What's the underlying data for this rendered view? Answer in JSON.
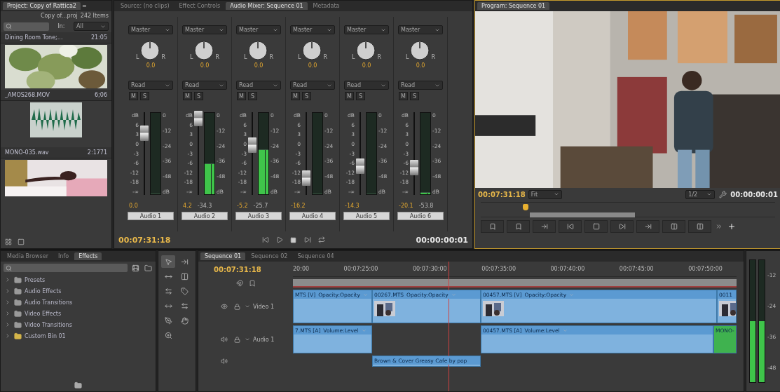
{
  "project": {
    "title": "Project: Copy of Rattica2",
    "menu": "≡",
    "path": "Copy of...proj",
    "count": "242 Items",
    "in_label": "In:",
    "in_value": "All",
    "items": [
      {
        "kind": "name-only",
        "name": "Dining Room Tone;...",
        "duration": "21:05"
      },
      {
        "kind": "video",
        "name": "_AMOS268.MOV",
        "duration": "6;06"
      },
      {
        "kind": "audio",
        "name": "MONO-035.wav",
        "duration": "2:1771"
      },
      {
        "kind": "video-cut"
      }
    ]
  },
  "mixer": {
    "tabs": [
      {
        "label": "Source: (no clips)",
        "selected": false
      },
      {
        "label": "Effect Controls",
        "selected": false
      },
      {
        "label": "Audio Mixer: Sequence 01",
        "selected": true
      },
      {
        "label": "Metadata",
        "selected": false
      }
    ],
    "channels": [
      {
        "send": "Master",
        "pan_left": "L",
        "pan_right": "R",
        "pan": "0.0",
        "automation": "Read",
        "mute": "M",
        "solo": "S",
        "fader_scale": [
          "dB",
          "6",
          "3",
          "0",
          "-3",
          "-6",
          "-12",
          "-18",
          "-∞"
        ],
        "meter_scale": [
          "0",
          "-12",
          "-24",
          "-36",
          "-48",
          "dB"
        ],
        "fader": {
          "level": 0.75
        },
        "meter": {
          "level": 0
        },
        "volume": "0.0",
        "name": "Audio 1"
      },
      {
        "send": "Master",
        "pan_left": "L",
        "pan_right": "R",
        "pan": "0.0",
        "automation": "Read",
        "mute": "M",
        "solo": "S",
        "fader_scale": [
          "dB",
          "6",
          "3",
          "0",
          "-3",
          "-6",
          "-12",
          "-18",
          "-∞"
        ],
        "meter_scale": [
          "0",
          "-12",
          "-24",
          "-36",
          "-48",
          "dB"
        ],
        "fader": {
          "level": 0.92
        },
        "meter": {
          "level": 0.38
        },
        "volume": "4.2",
        "peak": "-34.3",
        "name": "Audio 2"
      },
      {
        "send": "Master",
        "pan_left": "L",
        "pan_right": "R",
        "pan": "0.0",
        "automation": "Read",
        "mute": "M",
        "solo": "S",
        "fader_scale": [
          "dB",
          "6",
          "3",
          "0",
          "-3",
          "-6",
          "-12",
          "-18",
          "-∞"
        ],
        "meter_scale": [
          "0",
          "-12",
          "-24",
          "-36",
          "-48",
          "dB"
        ],
        "fader": {
          "level": 0.6
        },
        "meter": {
          "level": 0.55
        },
        "volume": "-5.2",
        "peak": "-25.7",
        "name": "Audio 3"
      },
      {
        "send": "Master",
        "pan_left": "L",
        "pan_right": "R",
        "pan": "0.0",
        "automation": "Read",
        "mute": "M",
        "solo": "S",
        "fader_scale": [
          "dB",
          "6",
          "3",
          "0",
          "-3",
          "-6",
          "-12",
          "-18",
          "-∞"
        ],
        "meter_scale": [
          "0",
          "-12",
          "-24",
          "-36",
          "-48",
          "dB"
        ],
        "fader": {
          "level": 0.2
        },
        "meter": {
          "level": 0
        },
        "volume": "-16.2",
        "name": "Audio 4"
      },
      {
        "send": "Master",
        "pan_left": "L",
        "pan_right": "R",
        "pan": "0.0",
        "automation": "Read",
        "mute": "M",
        "solo": "S",
        "fader_scale": [
          "dB",
          "6",
          "3",
          "0",
          "-3",
          "-6",
          "-12",
          "-18",
          "-∞"
        ],
        "meter_scale": [
          "0",
          "-12",
          "-24",
          "-36",
          "-48",
          "dB"
        ],
        "fader": {
          "level": 0.35
        },
        "meter": {
          "level": 0
        },
        "volume": "-14.3",
        "name": "Audio 5"
      },
      {
        "send": "Master",
        "pan_left": "L",
        "pan_right": "R",
        "pan": "0.0",
        "automation": "Read",
        "mute": "M",
        "solo": "S",
        "fader_scale": [
          "dB",
          "6",
          "3",
          "0",
          "-3",
          "-6",
          "-12",
          "-18",
          "-∞"
        ],
        "meter_scale": [
          "0",
          "-12",
          "-24",
          "-36",
          "-48",
          "dB"
        ],
        "fader": {
          "level": 0.33
        },
        "meter": {
          "level": 0.03
        },
        "volume": "-20.1",
        "peak": "-53.8",
        "name": "Audio 6"
      }
    ],
    "timecode": "00:07:31:18",
    "duration": "00:00:00:01"
  },
  "program": {
    "title": "Program: Sequence 01",
    "timecode": "00:07:31:18",
    "zoom": "Fit",
    "resolution": "1/2",
    "duration": "00:00:00:01"
  },
  "effects": {
    "tabs": [
      {
        "label": "Media Browser",
        "selected": false
      },
      {
        "label": "Info",
        "selected": false
      },
      {
        "label": "Effects",
        "selected": true
      }
    ],
    "tree": [
      {
        "label": "Presets",
        "kind": "preset",
        "expanded": false
      },
      {
        "label": "Audio Effects",
        "kind": "bin",
        "expanded": false
      },
      {
        "label": "Audio Transitions",
        "kind": "bin",
        "expanded": false
      },
      {
        "label": "Video Effects",
        "kind": "bin",
        "expanded": false
      },
      {
        "label": "Video Transitions",
        "kind": "bin",
        "expanded": false
      },
      {
        "label": "Custom Bin 01",
        "kind": "custom",
        "expanded": false
      }
    ]
  },
  "tools": [
    {
      "selected": true
    },
    {
      "selected": false
    },
    {
      "selected": false
    },
    {
      "selected": false
    },
    {
      "selected": false
    },
    {
      "selected": false
    },
    {
      "selected": false
    },
    {
      "selected": false
    },
    {
      "selected": false
    },
    {
      "selected": false
    },
    {
      "selected": false
    }
  ],
  "timeline": {
    "tabs": [
      {
        "label": "Sequence 01",
        "selected": true
      },
      {
        "label": "Sequence 02",
        "selected": false
      },
      {
        "label": "Sequence 04",
        "selected": false
      }
    ],
    "timecode": "00:07:31:18",
    "ruler": [
      "20:00",
      "00:07:25:00",
      "00:07:30:00",
      "00:07:35:00",
      "00:07:40:00",
      "00:07:45:00",
      "00:07:50:00"
    ],
    "tracks": [
      {
        "kind": "video",
        "name": "Video 1",
        "expanded": true,
        "clips": [
          {
            "kind": "clip",
            "name": "MTS [V]",
            "effect": "Opacity:Opacity"
          },
          {
            "kind": "clip",
            "name": "00267.MTS",
            "effect": "Opacity:Opacity",
            "thumb": true
          },
          {
            "kind": "clip",
            "name": "00457.MTS [V]",
            "effect": "Opacity:Opacity",
            "thumb": true
          },
          {
            "kind": "clip",
            "name": "0011",
            "thumb": true
          }
        ]
      },
      {
        "kind": "audio",
        "name": "Audio 1",
        "expanded": true,
        "clips": [
          {
            "kind": "clip",
            "name": "7.MTS [A]",
            "effect": "Volume:Level"
          },
          {
            "kind": "gap"
          },
          {
            "kind": "clip",
            "name": "00457.MTS [A]",
            "effect": "Volume:Level"
          },
          {
            "kind": "clip",
            "name": "MONO-",
            "color": "#3fb24f"
          }
        ]
      },
      {
        "kind": "audio-collapsed",
        "clips": [
          {
            "kind": "gap"
          },
          {
            "kind": "clip",
            "name": "Brown & Cover Greasy Cafe by pop"
          }
        ]
      }
    ]
  },
  "master_meter": {
    "left": {
      "level": 0.5
    },
    "right": {
      "level": 0.5
    },
    "scale": [
      "-12",
      "-24",
      "-36",
      "-48"
    ]
  }
}
